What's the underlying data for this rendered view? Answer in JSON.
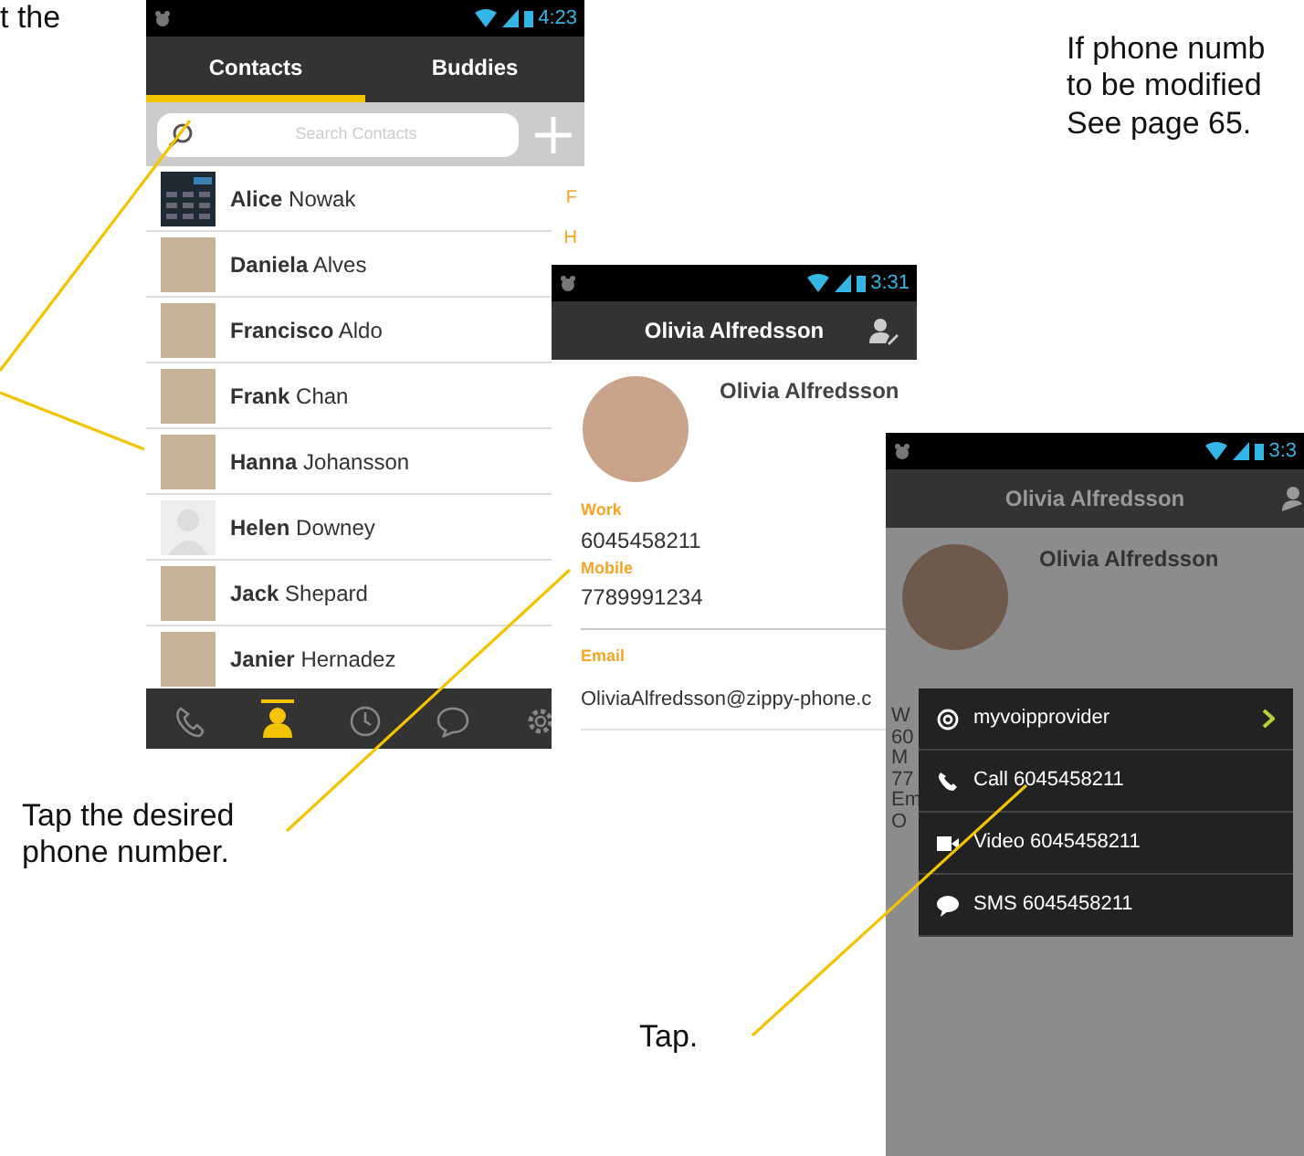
{
  "captions": {
    "top_left": "t the",
    "top_right": [
      "If phone numb",
      "to be modified",
      "See page 65."
    ],
    "tap_number": "Tap the desired phone number.",
    "tap": "Tap."
  },
  "contacts_screen": {
    "status_time": "4:23",
    "tabs": [
      {
        "label": "Contacts",
        "selected": true
      },
      {
        "label": "Buddies",
        "selected": false
      }
    ],
    "search": {
      "placeholder": "Search Contacts"
    },
    "contacts": [
      {
        "name": "**Alice** Nowak",
        "kind": "screenshot"
      },
      {
        "name": "**Daniela** Alves",
        "kind": "photo"
      },
      {
        "name": "**Francisco** Aldo",
        "kind": "photo"
      },
      {
        "name": "**Frank** Chan",
        "kind": "photo"
      },
      {
        "name": "**Hanna** Johansson",
        "kind": "photo"
      },
      {
        "name": "**Helen** Downey",
        "kind": "silhouette"
      },
      {
        "name": "**Jack** Shepard",
        "kind": "photo"
      },
      {
        "name": "**Janier** Hernadez",
        "kind": "photo"
      }
    ],
    "index_letters": [
      "F",
      "H"
    ],
    "nav": [
      {
        "kind": "phone",
        "selected": false
      },
      {
        "kind": "person",
        "selected": true
      },
      {
        "kind": "clock",
        "selected": false
      },
      {
        "kind": "chat",
        "selected": false
      },
      {
        "kind": "gear",
        "selected": false
      }
    ]
  },
  "detail_screen": {
    "status_time": "3:31",
    "title": "Olivia Alfredsson",
    "name": "Olivia Alfredsson",
    "fields": [
      {
        "label": "Work",
        "value": "6045458211"
      },
      {
        "label": "Mobile",
        "value": "7789991234"
      }
    ],
    "email": {
      "label": "Email",
      "value": "OliviaAlfredsson@zippy-phone.c"
    }
  },
  "menu_screen": {
    "status_time": "3:3",
    "title": "Olivia Alfredsson",
    "name": "Olivia Alfredsson",
    "behind": [
      "W",
      "60",
      "M",
      "77",
      "Em",
      "O"
    ],
    "menu": [
      {
        "kind": "at",
        "label": "myvoipprovider",
        "submenu": true
      },
      {
        "kind": "phone",
        "label": "Call 6045458211",
        "submenu": false
      },
      {
        "kind": "video",
        "label": "Video 6045458211",
        "submenu": false
      },
      {
        "kind": "sms",
        "label": "SMS 6045458211",
        "submenu": false
      }
    ]
  }
}
